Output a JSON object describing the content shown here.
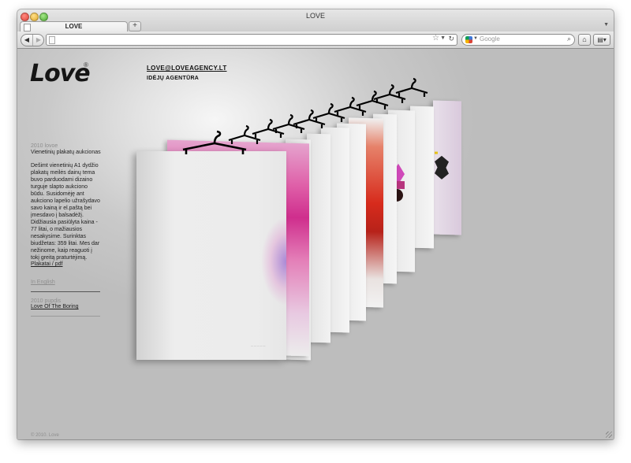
{
  "window": {
    "title": "LOVE"
  },
  "tabs": [
    {
      "label": "LOVE"
    }
  ],
  "new_tab_label": "+",
  "address_bar": {
    "url": ""
  },
  "search_bar": {
    "placeholder": "Google"
  },
  "page": {
    "logo": "Love",
    "logo_mark": "®",
    "email": "LOVE@LOVEAGENCY.LT",
    "agency_tagline": "IDĖJŲ AGENTŪRA",
    "project_2010_year": "2010 lovoe",
    "project_2010_title": "Vienetinių plakatų aukcionas",
    "description": "Dešimt vienetinių A1 dydžio plakatų meilės dainų tema buvo parduodami dizaino turguje slapto aukciono būdu. Susidomėję ant aukciono lapelio užrašydavo savo kainą ir el.paštą bei įmesdavo į balsadėžį. Didžiausia pasiūlyta kaina - 77 litai, o mažiausios nesakysime. Surinktas biudžetas: 359 litai. Mes dar nežinome, kaip reaguoti į tokį greitą praturtėjimą.",
    "posters_link": "Plakatai / pdf",
    "english_link": "In English",
    "project_2010_b_year": "2010 pupdis",
    "project_2010_b_link": "Love Of The Boring",
    "copyright": "© 2010. Love"
  },
  "icons": {
    "back": "back-arrow-icon",
    "forward": "forward-arrow-icon",
    "star": "bookmark-star-icon",
    "reload": "reload-icon",
    "search": "magnifier-icon",
    "home": "home-icon",
    "menu": "bookmarks-menu-icon"
  },
  "colors": {
    "background": "#bebebe",
    "text": "#151515",
    "muted": "#8e8e8e"
  }
}
